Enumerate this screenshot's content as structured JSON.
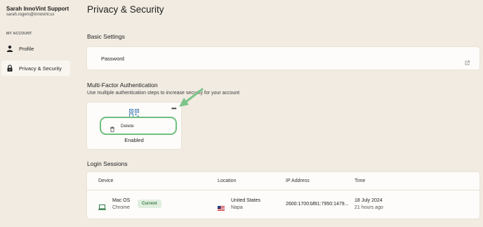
{
  "sidebar": {
    "user_name": "Sarah InnoVint Support",
    "user_email": "sarah.rogers@innovint.us",
    "section_label": "MY ACCOUNT",
    "items": [
      {
        "label": "Profile",
        "icon": "person-icon",
        "active": false
      },
      {
        "label": "Privacy & Security",
        "icon": "lock-icon",
        "active": true
      }
    ]
  },
  "main": {
    "title": "Privacy & Security",
    "basic_settings": {
      "heading": "Basic Settings",
      "password_label": "Password",
      "icon": "external-link-icon"
    },
    "mfa": {
      "heading": "Multi-Factor Authentication",
      "subtitle": "Use multiple authentication steps to increase security for your account",
      "card_icon": "qr-code-icon",
      "status": "Enabled",
      "menu_icon": "more-horizontal-icon",
      "popup_item": {
        "label": "Delete",
        "icon": "trash-icon"
      }
    },
    "login_sessions": {
      "heading": "Login Sessions",
      "columns": [
        "Device",
        "Location",
        "IP Address",
        "Time"
      ],
      "rows": [
        {
          "device": "Mac OS",
          "browser": "Chrome",
          "badge": "Current",
          "country": "United States",
          "city": "Napa",
          "ip": "2600:1700:bf81:7950:1479...",
          "date": "18 July 2024",
          "ago": "21 hours ago"
        }
      ]
    }
  },
  "colors": {
    "page_bg": "#f1ebe1",
    "card_bg": "#fdfcfa",
    "accent_green": "#6fbf7e",
    "qr_blue": "#4a7fb5",
    "badge_bg": "#dfeede",
    "badge_text": "#3f7e4d"
  }
}
